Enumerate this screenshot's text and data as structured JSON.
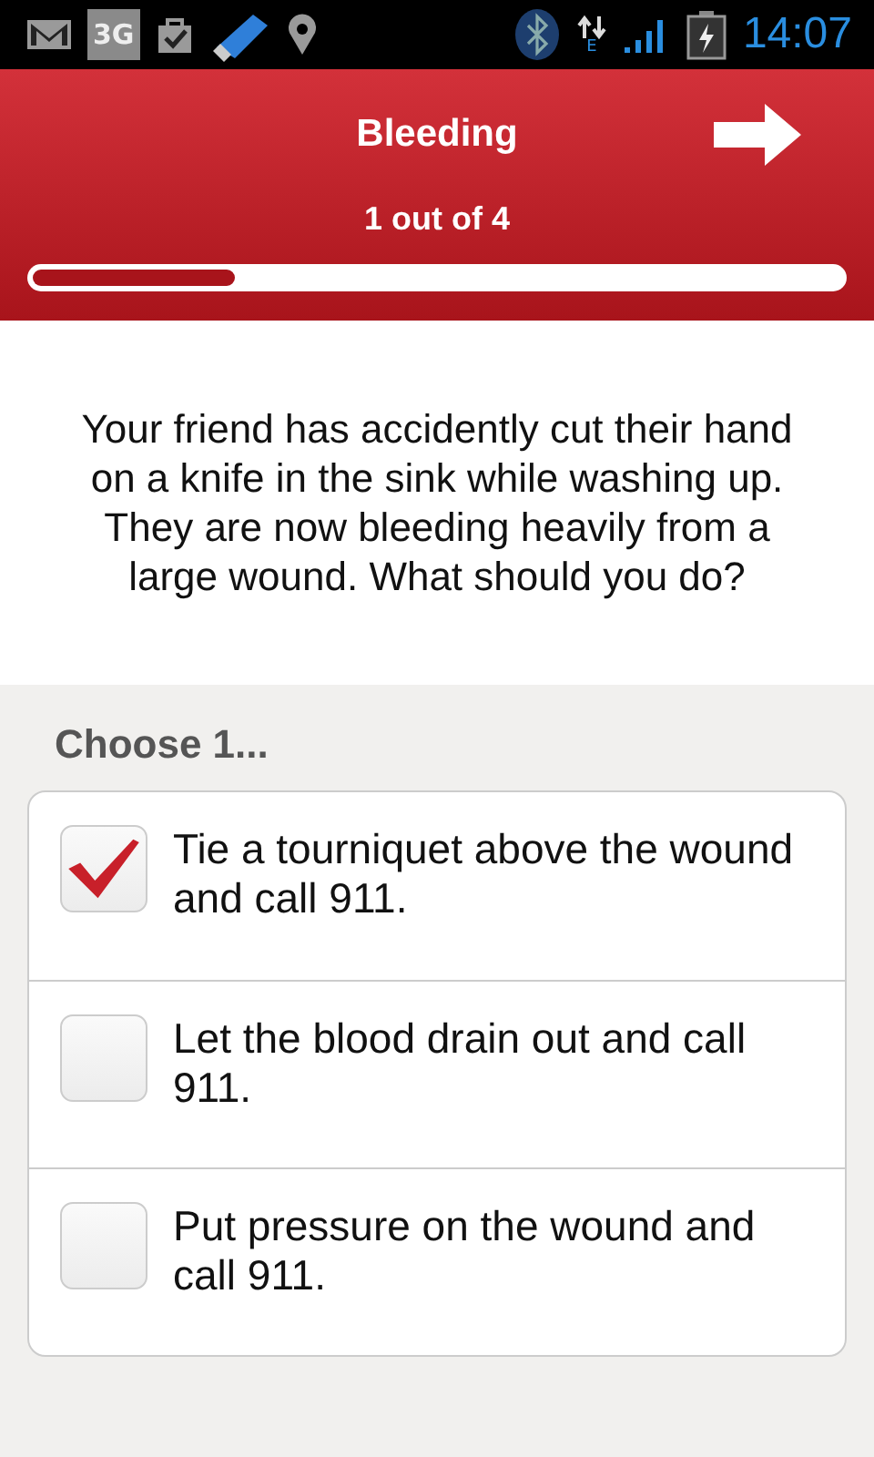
{
  "status_bar": {
    "network_label": "3G",
    "data_label": "E",
    "time": "14:07"
  },
  "header": {
    "title": "Bleeding",
    "counter": "1 out of 4",
    "progress": {
      "level": 0.25
    }
  },
  "question": "Your friend has accidently cut their hand on a knife in the sink while washing up. They are now bleeding heavily from a large wound. What should you do?",
  "prompt": "Choose 1...",
  "options": [
    {
      "label": "Tie a tourniquet above the wound and call 911.",
      "checked": true
    },
    {
      "label": "Let the blood drain out and call 911.",
      "checked": false
    },
    {
      "label": "Put pressure on the wound and call 911.",
      "checked": false
    }
  ]
}
